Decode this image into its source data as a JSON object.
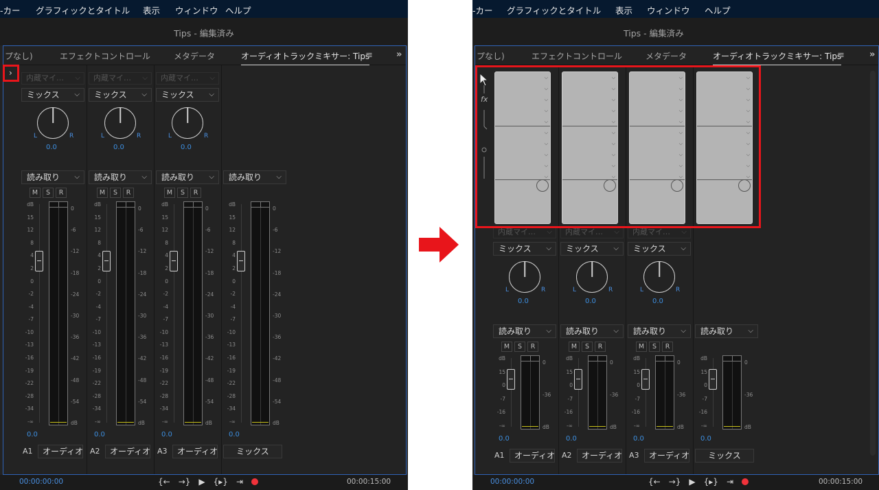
{
  "colors": {
    "accent_blue": "#3d8fe0",
    "highlight_red": "#e8151b",
    "panel_bg": "#232323",
    "menubar_bg": "#06192f"
  },
  "menu": {
    "items": [
      "-カー",
      "グラフィックとタイトル",
      "表示",
      "ウィンドウ",
      "ヘルプ"
    ]
  },
  "document_title": "Tips - 編集済み",
  "tabs": {
    "t1": "プなし)",
    "t2": "エフェクトコントロール",
    "t3": "メタデータ",
    "t4": "オーディオトラックミキサー: Tips",
    "menu_icon": "≡",
    "overflow_icon": "»"
  },
  "strip": {
    "input_label": "内蔵マイ…",
    "mix_label": "ミックス",
    "pan_value": "0.0",
    "pan_l": "L",
    "pan_r": "R",
    "automation": "読み取り",
    "m": "M",
    "s": "S",
    "r": "R",
    "fader_value": "0.0",
    "db": "dB",
    "chev": "⌵"
  },
  "tracks": [
    {
      "id": "A1",
      "name": "オーディオ"
    },
    {
      "id": "A2",
      "name": "オーディオ"
    },
    {
      "id": "A3",
      "name": "オーディオ"
    },
    {
      "id": "",
      "name": "ミックス"
    }
  ],
  "left_scale_full": [
    "dB",
    "15",
    "12",
    "8",
    "4",
    "2",
    "0",
    "-2",
    "-4",
    "-7",
    "-10",
    "-13",
    "-16",
    "-19",
    "-22",
    "-28",
    "-34",
    "-∞"
  ],
  "meter_scale_full": [
    "0",
    "-6",
    "-12",
    "-18",
    "-24",
    "-30",
    "-36",
    "-42",
    "-48",
    "-54",
    "dB"
  ],
  "left_scale_short": [
    "dB",
    "15",
    "0",
    "-7",
    "-16",
    "-∞"
  ],
  "meter_scale_short": [
    "0",
    "-36",
    "dB"
  ],
  "transport": {
    "start_tc": "00:00:00:00",
    "end_tc": "00:00:15:00",
    "b1": "{←",
    "b2": "→}",
    "b3": "▶",
    "b4": "{▸}",
    "b5": "⇥"
  },
  "expand_button": "›",
  "fx_label": "fx"
}
